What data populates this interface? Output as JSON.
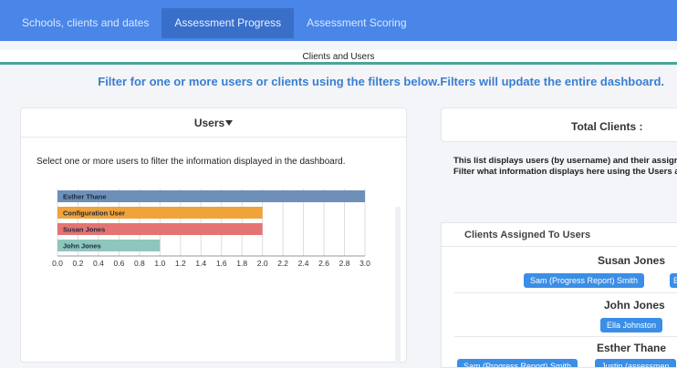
{
  "tabs": [
    {
      "label": "Schools, clients and dates"
    },
    {
      "label": "Assessment Progress"
    },
    {
      "label": "Assessment Scoring"
    }
  ],
  "subheader": "Clients and Users",
  "filter_instruction": "Filter for one or more users or clients using the filters below.Filters will update the entire dashboard.",
  "users_card": {
    "title": "Users",
    "description": "Select one or more users to filter the information displayed in the dashboard."
  },
  "chart_data": {
    "type": "bar",
    "orientation": "horizontal",
    "categories": [
      "Esther Thane",
      "Configuration User",
      "Susan Jones",
      "John Jones"
    ],
    "values": [
      3.0,
      2.0,
      2.0,
      1.0
    ],
    "colors": [
      "#6d8fb8",
      "#f0a23b",
      "#e57373",
      "#8ec6bd"
    ],
    "xlim": [
      0,
      3.0
    ],
    "xticks": [
      "0.0",
      "0.2",
      "0.4",
      "0.6",
      "0.8",
      "1.0",
      "1.2",
      "1.4",
      "1.6",
      "1.8",
      "2.0",
      "2.2",
      "2.4",
      "2.6",
      "2.8",
      "3.0"
    ],
    "grid": true
  },
  "total_clients": {
    "label": "Total Clients :"
  },
  "right_description": {
    "line1": "This list displays users (by username) and their assigr",
    "line2": "Filter what information displays here using the Users a"
  },
  "clients_assigned": {
    "title": "Clients Assigned To Users",
    "groups": [
      {
        "user": "Susan Jones",
        "clients": [
          "Sam (Progress Report) Smith",
          "El"
        ]
      },
      {
        "user": "John Jones",
        "clients": [
          "Ella Johnston"
        ]
      },
      {
        "user": "Esther Thane",
        "clients": [
          "Sam (Progress Report) Smith",
          "Justin (assessmen"
        ]
      }
    ]
  }
}
